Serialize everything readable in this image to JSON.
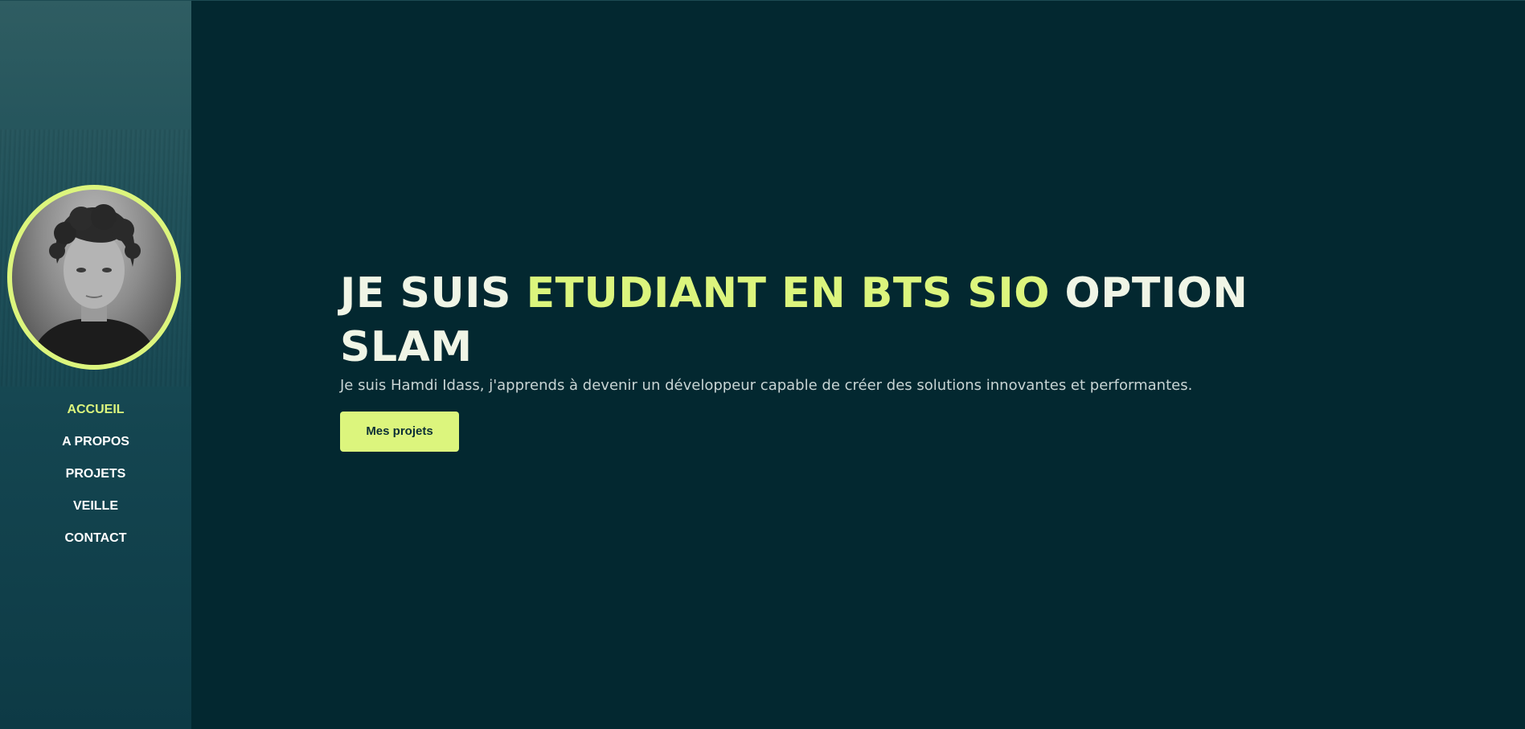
{
  "profile": {
    "photo_alt": "Hamdi Idass"
  },
  "nav": {
    "items": [
      {
        "label": "ACCUEIL",
        "active": true
      },
      {
        "label": "A PROPOS",
        "active": false
      },
      {
        "label": "PROJETS",
        "active": false
      },
      {
        "label": "VEILLE",
        "active": false
      },
      {
        "label": "CONTACT",
        "active": false
      }
    ]
  },
  "hero": {
    "title_prefix": "JE SUIS ",
    "title_highlight": "ETUDIANT EN BTS SIO",
    "title_suffix": " OPTION SLAM",
    "subtitle": "Je suis Hamdi Idass, j'apprends à devenir un développeur capable de créer des solutions innovantes et performantes.",
    "cta_label": "Mes projets"
  },
  "colors": {
    "background": "#032830",
    "accent": "#dcf57d",
    "text": "#f0f5e6"
  }
}
